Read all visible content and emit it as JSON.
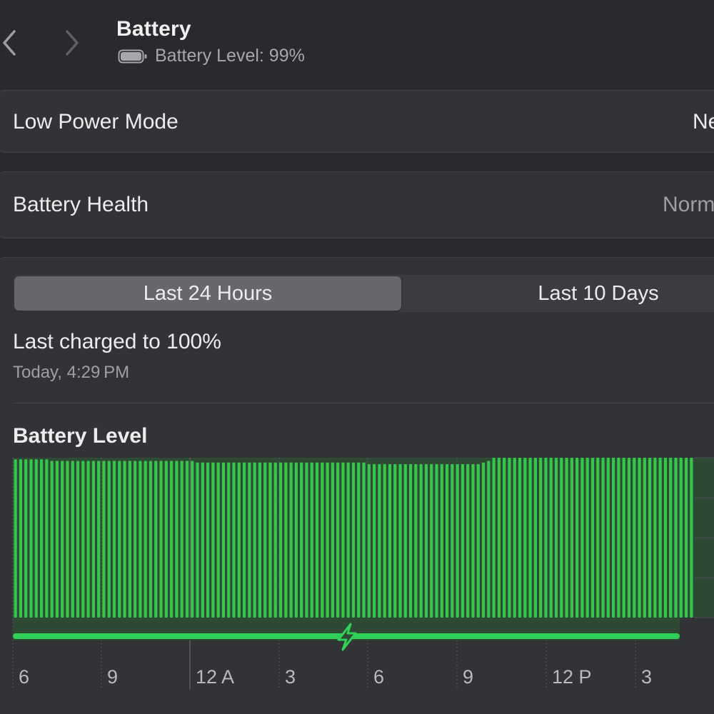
{
  "header": {
    "title": "Battery",
    "battery_level_text": "Battery Level: 99%",
    "back_icon": "chevron-left-icon",
    "forward_icon": "chevron-right-icon",
    "battery_icon": "battery-icon"
  },
  "settings": {
    "low_power_mode": {
      "label": "Low Power Mode",
      "value": "Ne"
    },
    "battery_health": {
      "label": "Battery Health",
      "value": "Norm"
    }
  },
  "usage": {
    "tabs": [
      {
        "label": "Last 24 Hours",
        "selected": true
      },
      {
        "label": "Last 10 Days",
        "selected": false
      }
    ],
    "last_charged": "Last charged to 100%",
    "last_charged_time": "Today, 4:29 PM"
  },
  "colors": {
    "bar_green": "#34c74c",
    "charging_green": "#30d158",
    "background": "#292a2d",
    "panel": "#323336"
  },
  "chart_data": {
    "type": "bar",
    "title": "Battery Level",
    "x_tick_labels": [
      "6",
      "9",
      "12 A",
      "3",
      "6",
      "9",
      "12 P",
      "3"
    ],
    "ylim": [
      0,
      100
    ],
    "series": [
      {
        "values": [
          99,
          99,
          99,
          99,
          99,
          99,
          99,
          98,
          98,
          98,
          98,
          98,
          98,
          98,
          98,
          98,
          98,
          98,
          98,
          98,
          98,
          98,
          98,
          98,
          98,
          98,
          98,
          98,
          98,
          98,
          98,
          98,
          98,
          98,
          98,
          97,
          97,
          97,
          97,
          97,
          97,
          97,
          97,
          97,
          97,
          97,
          97,
          97,
          97,
          97,
          97,
          97,
          97,
          97,
          97,
          97,
          97,
          97,
          97,
          97,
          97,
          97,
          97,
          97,
          97,
          97,
          97,
          97,
          96,
          96,
          96,
          96,
          96,
          96,
          96,
          96,
          96,
          96,
          96,
          96,
          96,
          96,
          96,
          96,
          96,
          96,
          96,
          96,
          96,
          96,
          97,
          98,
          100,
          100,
          100,
          100,
          100,
          100,
          100,
          100,
          100,
          100,
          100,
          100,
          100,
          100,
          100,
          100,
          100,
          100,
          100,
          100,
          100,
          100,
          100,
          100,
          100,
          100,
          100,
          100,
          100,
          100,
          100,
          100,
          100,
          100,
          100,
          100,
          100,
          100,
          100
        ]
      }
    ],
    "charging_intervals": [
      [
        0,
        1
      ]
    ],
    "grid": true
  }
}
